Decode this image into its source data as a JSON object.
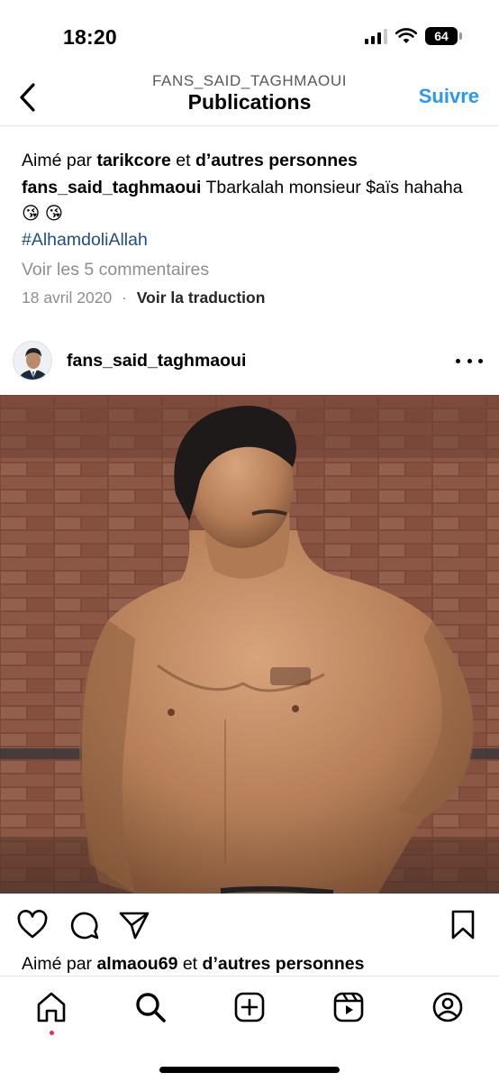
{
  "status_bar": {
    "time": "18:20",
    "battery": "64"
  },
  "header": {
    "subtitle": "FANS_SAID_TAGHMAOUI",
    "title": "Publications",
    "follow_label": "Suivre"
  },
  "previous_post": {
    "likes_prefix": "Aimé par ",
    "likes_user": "tarikcore",
    "likes_middle": " et ",
    "likes_suffix": "d’autres personnes",
    "caption_user": "fans_said_taghmaoui",
    "caption_text": " Tbarkalah monsieur $aïs hahaha😘 😘",
    "hashtag": "#AlhamdoliAllah",
    "comments_link": "Voir les 5 commentaires",
    "date": "18 avril 2020",
    "separator": "·",
    "translate_label": "Voir la traduction"
  },
  "post": {
    "username": "fans_said_taghmaoui",
    "photo_icon": "shirtless-man-photo",
    "likes_prefix": "Aimé par ",
    "likes_user": "almaou69",
    "likes_middle": " et ",
    "likes_suffix": "d’autres personnes"
  },
  "tab_bar": {
    "items": [
      "home-icon",
      "search-icon",
      "create-icon",
      "reels-icon",
      "profile-icon"
    ],
    "active": "home-icon",
    "notification_color": "#ed2e4b"
  },
  "colors": {
    "follow": "#2a98f0",
    "hashtag": "#1d4d8a",
    "muted": "#8e8e8e"
  }
}
